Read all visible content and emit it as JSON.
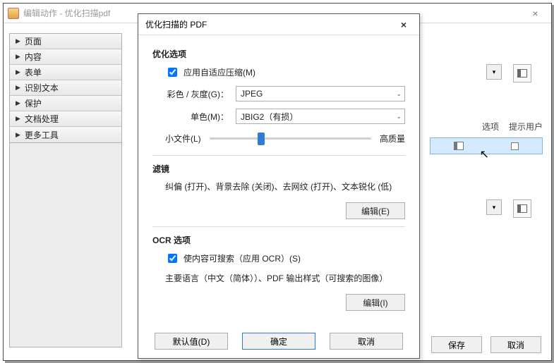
{
  "app": {
    "title": "编辑动作 - 优化扫描pdf",
    "close_glyph": "×"
  },
  "sidebar": {
    "items": [
      {
        "label": "页面"
      },
      {
        "label": "内容"
      },
      {
        "label": "表单"
      },
      {
        "label": "识别文本"
      },
      {
        "label": "保护"
      },
      {
        "label": "文档处理"
      },
      {
        "label": "更多工具"
      }
    ]
  },
  "main": {
    "col1": "选项",
    "col2": "提示用户",
    "save": "保存",
    "cancel": "取消",
    "dropdown_glyph": "▾"
  },
  "dialog": {
    "title": "优化扫描的 PDF",
    "close_glyph": "×",
    "opt_heading": "优化选项",
    "adaptive_label": "应用自适应压缩(M)",
    "adaptive_checked": true,
    "color_label": "彩色 / 灰度(G)：",
    "color_value": "JPEG",
    "mono_label": "单色(M)：",
    "mono_value": "JBIG2（有损）",
    "slider_left": "小文件(L)",
    "slider_right": "高质量",
    "filter_heading": "滤镜",
    "filter_text": "纠偏 (打开)、背景去除 (关闭)、去网纹 (打开)、文本锐化 (低)",
    "filter_edit": "编辑(E)",
    "ocr_heading": "OCR 选项",
    "ocr_check_label": "使内容可搜索（应用 OCR）(S)",
    "ocr_checked": true,
    "ocr_summary": "主要语言（中文（简体））、PDF 输出样式（可搜索的图像）",
    "ocr_edit": "编辑(I)",
    "default_btn": "默认值(D)",
    "ok_btn": "确定",
    "cancel_btn": "取消"
  }
}
